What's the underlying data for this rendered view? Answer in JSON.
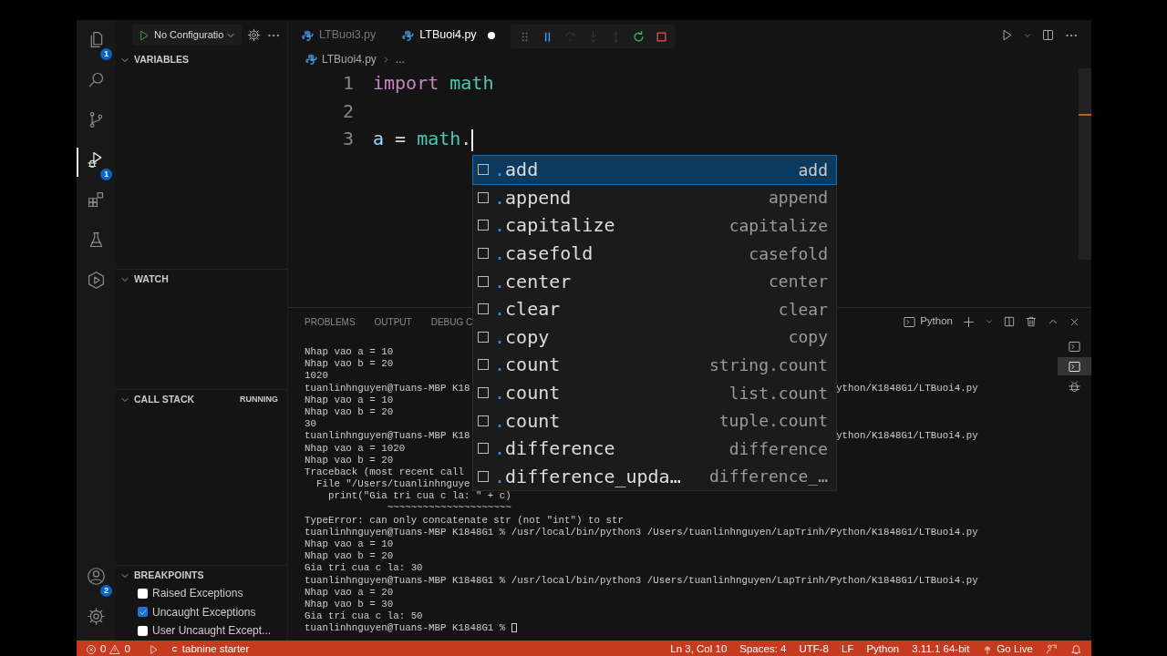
{
  "activity_bar": {
    "items": [
      {
        "kind": "files",
        "badge": "1",
        "selected": false
      },
      {
        "kind": "search",
        "selected": false
      },
      {
        "kind": "branch",
        "selected": false
      },
      {
        "kind": "debug",
        "badge": "1",
        "selected": true
      },
      {
        "kind": "extensions",
        "selected": false
      },
      {
        "kind": "flask",
        "selected": false
      },
      {
        "kind": "remote",
        "selected": false
      }
    ],
    "bottom_items": [
      {
        "kind": "account",
        "badge": "2"
      },
      {
        "kind": "settings"
      }
    ]
  },
  "run_config": {
    "label": "No Configuratio"
  },
  "sidebar": {
    "sections": [
      {
        "title": "VARIABLES",
        "expanded": true
      },
      {
        "title": "WATCH",
        "expanded": true
      },
      {
        "title": "CALL STACK",
        "expanded": true,
        "status": "RUNNING"
      },
      {
        "title": "BREAKPOINTS",
        "expanded": true,
        "items": [
          {
            "label": "Raised Exceptions",
            "checked": false
          },
          {
            "label": "Uncaught Exceptions",
            "checked": true
          },
          {
            "label": "User Uncaught Except...",
            "checked": false
          }
        ]
      }
    ]
  },
  "tabs": [
    {
      "label": "LTBuoi3.py",
      "selected": false,
      "modified": false
    },
    {
      "label": "LTBuoi4.py",
      "selected": true,
      "modified": true
    }
  ],
  "debug_toolbar": [
    {
      "kind": "grip",
      "disabled": false
    },
    {
      "kind": "pause",
      "disabled": false
    },
    {
      "kind": "step_over",
      "disabled": true
    },
    {
      "kind": "step_into",
      "disabled": true
    },
    {
      "kind": "step_out",
      "disabled": true
    },
    {
      "kind": "restart",
      "disabled": false
    },
    {
      "kind": "stop",
      "disabled": false
    }
  ],
  "breadcrumb": {
    "file": "LTBuoi4.py",
    "more": "..."
  },
  "editor": {
    "lines": [
      {
        "number": "1",
        "tokens": [
          {
            "text": "import",
            "kind": "keyword"
          },
          {
            "text": " math",
            "kind": "module"
          }
        ]
      },
      {
        "number": "2"
      },
      {
        "number": "3",
        "cursor": true,
        "tokens": [
          {
            "text": "a",
            "kind": "variable"
          },
          {
            "text": " = ",
            "kind": "plain"
          },
          {
            "text": "math",
            "kind": "module"
          },
          {
            "text": ".",
            "kind": "plain"
          }
        ]
      }
    ]
  },
  "suggestions": [
    {
      "prefix": ".",
      "label": "add",
      "detail": "add",
      "selected": true
    },
    {
      "prefix": ".",
      "label": "append",
      "detail": "append",
      "selected": false
    },
    {
      "prefix": ".",
      "label": "capitalize",
      "detail": "capitalize",
      "selected": false
    },
    {
      "prefix": ".",
      "label": "casefold",
      "detail": "casefold",
      "selected": false
    },
    {
      "prefix": ".",
      "label": "center",
      "detail": "center",
      "selected": false
    },
    {
      "prefix": ".",
      "label": "clear",
      "detail": "clear",
      "selected": false
    },
    {
      "prefix": ".",
      "label": "copy",
      "detail": "copy",
      "selected": false
    },
    {
      "prefix": ".",
      "label": "count",
      "detail": "string.count",
      "selected": false
    },
    {
      "prefix": ".",
      "label": "count",
      "detail": "list.count",
      "selected": false
    },
    {
      "prefix": ".",
      "label": "count",
      "detail": "tuple.count",
      "selected": false
    },
    {
      "prefix": ".",
      "label": "difference",
      "detail": "difference",
      "selected": false
    },
    {
      "prefix": ".",
      "label": "difference_upda…",
      "detail": "difference_…",
      "selected": false
    }
  ],
  "panel": {
    "tabs": [
      "PROBLEMS",
      "OUTPUT",
      "DEBUG C"
    ],
    "terminal_name": "Python",
    "side_terminals": [
      {
        "kind": "terminal",
        "selected": false
      },
      {
        "kind": "terminal",
        "selected": true
      },
      {
        "kind": "debug",
        "selected": false
      }
    ],
    "terminal_lines": [
      {
        "text": "Nhap vao a = 10"
      },
      {
        "text": "Nhap vao b = 20"
      },
      {
        "text": "1020"
      },
      {
        "text": "tuanlinhnguyen@Tuans-MBP K18",
        "right": "ython/K1848G1/LTBuoi4.py"
      },
      {
        "text": "Nhap vao a = 10"
      },
      {
        "text": "Nhap vao b = 20"
      },
      {
        "text": "30"
      },
      {
        "text": "tuanlinhnguyen@Tuans-MBP K18",
        "right": "ython/K1848G1/LTBuoi4.py"
      },
      {
        "text": "Nhap vao a = 1020"
      },
      {
        "text": "Nhap vao b = 20"
      },
      {
        "text": "Traceback (most recent call"
      },
      {
        "text": "  File \"/Users/tuanlinhnguye"
      },
      {
        "text": "    print(\"Gia tri cua c la: \" + c)"
      },
      {
        "text": "              ~~~~~~~~~~~~~~~~~~~~~"
      },
      {
        "text": "TypeError: can only concatenate str (not \"int\") to str"
      },
      {
        "text": "tuanlinhnguyen@Tuans-MBP K1848G1 % /usr/local/bin/python3 /Users/tuanlinhnguyen/LapTrinh/Python/K1848G1/LTBuoi4.py"
      },
      {
        "text": "Nhap vao a = 10"
      },
      {
        "text": "Nhap vao b = 20"
      },
      {
        "text": "Gia tri cua c la: 30"
      },
      {
        "text": "tuanlinhnguyen@Tuans-MBP K1848G1 % /usr/local/bin/python3 /Users/tuanlinhnguyen/LapTrinh/Python/K1848G1/LTBuoi4.py"
      },
      {
        "text": "Nhap vao a = 20"
      },
      {
        "text": "Nhap vao b = 30"
      },
      {
        "text": "Gia tri cua c la: 50"
      },
      {
        "text": "tuanlinhnguyen@Tuans-MBP K1848G1 % ",
        "cursor": true
      }
    ]
  },
  "status_bar": {
    "errors": "0",
    "warnings": "0",
    "extension": "tabnine starter",
    "right": [
      {
        "kind": "text",
        "label": "Ln 3, Col 10"
      },
      {
        "kind": "text",
        "label": "Spaces: 4"
      },
      {
        "kind": "text",
        "label": "UTF-8"
      },
      {
        "kind": "text",
        "label": "LF"
      },
      {
        "kind": "text",
        "label": "Python"
      },
      {
        "kind": "text",
        "label": "3.11.1 64-bit"
      },
      {
        "kind": "live",
        "label": "Go Live"
      },
      {
        "kind": "feedback"
      },
      {
        "kind": "bell"
      }
    ]
  }
}
